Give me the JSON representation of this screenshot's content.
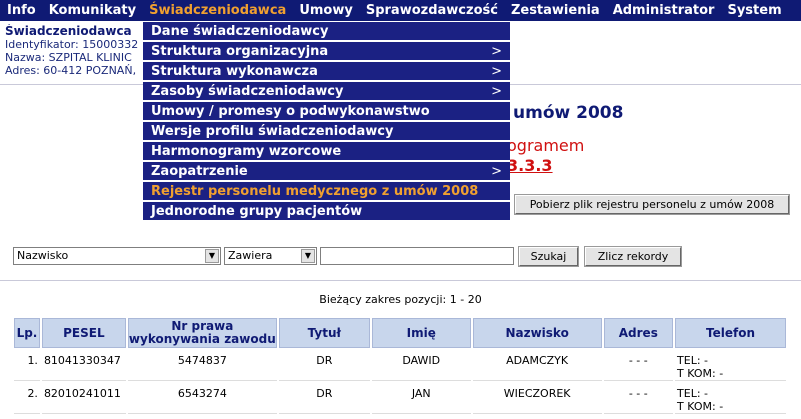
{
  "menubar": {
    "items": [
      "Info",
      "Komunikaty",
      "Świadczeniodawca",
      "Umowy",
      "Sprawozdawczość",
      "Zestawienia",
      "Administrator",
      "System"
    ],
    "active_index": 2
  },
  "provider": {
    "title": "Świadczeniodawca",
    "id_line": "Identyfikator: 15000332",
    "name_line": "Nazwa: SZPITAL KLINIC",
    "addr_line": "Adres: 60-412 POZNAŃ,"
  },
  "dropdown": {
    "items": [
      {
        "label": "Dane świadczeniodawcy",
        "submenu": false
      },
      {
        "label": "Struktura organizacyjna",
        "submenu": true
      },
      {
        "label": "Struktura wykonawcza",
        "submenu": true
      },
      {
        "label": "Zasoby świadczeniodawcy",
        "submenu": true
      },
      {
        "label": "Umowy / promesy o podwykonawstwo",
        "submenu": false
      },
      {
        "label": "Wersje profilu świadczeniodawcy",
        "submenu": false
      },
      {
        "label": "Harmonogramy wzorcowe",
        "submenu": false
      },
      {
        "label": "Zaopatrzenie",
        "submenu": true
      },
      {
        "label": "Rejestr personelu medycznego z umów 2008",
        "submenu": false,
        "selected": true
      },
      {
        "label": "Jednorodne grupy pacjentów",
        "submenu": false
      }
    ],
    "arrow": ">"
  },
  "heading": {
    "main": "umów 2008",
    "sub": "ogramem",
    "version": "3.3.3"
  },
  "download_button": "Pobierz plik rejestru personelu z umów 2008",
  "search": {
    "field_select": "Nazwisko",
    "mode_select": "Zawiera",
    "query_value": "",
    "search_button": "Szukaj",
    "count_button": "Zlicz rekordy"
  },
  "range_text": "Bieżący zakres pozycji: 1 - 20",
  "table": {
    "headers": [
      "Lp.",
      "PESEL",
      "Nr prawa wykonywania zawodu",
      "Tytuł",
      "Imię",
      "Nazwisko",
      "Adres",
      "Telefon"
    ],
    "rows": [
      {
        "lp": "1.",
        "pesel": "81041330347",
        "nr": "5474837",
        "tytul": "DR",
        "imie": "DAWID",
        "nazwisko": "ADAMCZYK",
        "adres": "- - -",
        "tel": "TEL: -",
        "tkom": "T KOM: -"
      },
      {
        "lp": "2.",
        "pesel": "82010241011",
        "nr": "6543274",
        "tytul": "DR",
        "imie": "JAN",
        "nazwisko": "WIECZOREK",
        "adres": "- - -",
        "tel": "TEL: -",
        "tkom": "T KOM: -"
      }
    ]
  },
  "colors": {
    "menubar": "#0f1a74",
    "active": "#f0a030",
    "heading": "#0f1a74",
    "accent_red": "#d01010"
  }
}
